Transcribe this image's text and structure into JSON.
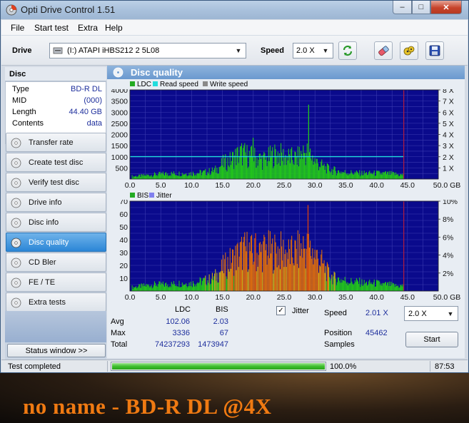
{
  "window": {
    "title": "Opti Drive Control 1.51",
    "minimize": "–",
    "maximize": "□",
    "close": "✕"
  },
  "menu": [
    "File",
    "Start test",
    "Extra",
    "Help"
  ],
  "toolbar": {
    "drive_label": "Drive",
    "drive_value": "(I:)   ATAPI iHBS212   2 5L08",
    "speed_label": "Speed",
    "speed_value": "2.0 X",
    "icons": [
      "refresh-icon",
      "eraser-icon",
      "burn-icon",
      "save-icon"
    ]
  },
  "disc": {
    "header": "Disc",
    "rows": [
      {
        "key": "Type",
        "value": "BD-R DL"
      },
      {
        "key": "MID",
        "value": "(000)"
      },
      {
        "key": "Length",
        "value": "44.40 GB"
      },
      {
        "key": "Contents",
        "value": "data"
      }
    ]
  },
  "nav": [
    {
      "label": "Transfer rate",
      "active": false
    },
    {
      "label": "Create test disc",
      "active": false
    },
    {
      "label": "Verify test disc",
      "active": false
    },
    {
      "label": "Drive info",
      "active": false
    },
    {
      "label": "Disc info",
      "active": false
    },
    {
      "label": "Disc quality",
      "active": true
    },
    {
      "label": "CD Bler",
      "active": false
    },
    {
      "label": "FE / TE",
      "active": false
    },
    {
      "label": "Extra tests",
      "active": false
    }
  ],
  "status_window_button": "Status window >>",
  "panel": {
    "title": "Disc quality"
  },
  "chart_data": [
    {
      "type": "bar",
      "legend": [
        {
          "name": "LDC",
          "color": "#22aa22"
        },
        {
          "name": "Read speed",
          "color": "#22dddd"
        },
        {
          "name": "Write speed",
          "color": "#8a8a8a"
        }
      ],
      "xlim": [
        0,
        50
      ],
      "x_ticks": [
        "0.0",
        "5.0",
        "10.0",
        "15.0",
        "20.0",
        "25.0",
        "30.0",
        "35.0",
        "40.0",
        "45.0",
        "50.0 GB"
      ],
      "ylim": [
        0,
        4000
      ],
      "y_ticks": [
        "500",
        "1000",
        "1500",
        "2000",
        "2500",
        "3000",
        "3500",
        "4000"
      ],
      "y2_ticks": [
        "1 X",
        "2 X",
        "3 X",
        "4 X",
        "5 X",
        "6 X",
        "7 X",
        "8 X"
      ],
      "ldc_profile": [
        [
          0.5,
          120
        ],
        [
          2,
          150
        ],
        [
          4,
          200
        ],
        [
          6,
          240
        ],
        [
          8,
          250
        ],
        [
          10,
          260
        ],
        [
          11,
          280
        ],
        [
          12,
          300
        ],
        [
          13,
          340
        ],
        [
          14,
          420
        ],
        [
          15,
          700
        ],
        [
          16,
          780
        ],
        [
          17,
          1000
        ],
        [
          18,
          1150
        ],
        [
          19,
          1050
        ],
        [
          20,
          980
        ],
        [
          21,
          900
        ],
        [
          22,
          860
        ],
        [
          23,
          1050
        ],
        [
          24,
          1100
        ],
        [
          25,
          1000
        ],
        [
          26,
          950
        ],
        [
          27,
          900
        ],
        [
          28,
          1200
        ],
        [
          29,
          1150
        ],
        [
          30,
          800
        ],
        [
          31,
          600
        ],
        [
          32,
          450
        ],
        [
          33,
          380
        ],
        [
          34,
          330
        ],
        [
          35,
          290
        ],
        [
          36,
          280
        ],
        [
          37,
          260
        ],
        [
          38,
          260
        ],
        [
          39,
          250
        ],
        [
          40,
          260
        ],
        [
          41,
          250
        ],
        [
          42,
          240
        ],
        [
          43,
          220
        ],
        [
          44,
          180
        ]
      ],
      "ldc_spikes": [
        [
          19.9,
          1850
        ],
        [
          28.9,
          3336
        ]
      ],
      "read_speed": [
        [
          0,
          2.01
        ],
        [
          44.4,
          2.01
        ]
      ],
      "marker_x": 44.4
    },
    {
      "type": "bar",
      "legend": [
        {
          "name": "BIS",
          "color": "#22aa22"
        },
        {
          "name": "Jitter",
          "color": "#8080ee"
        }
      ],
      "xlim": [
        0,
        50
      ],
      "x_ticks": [
        "0.0",
        "5.0",
        "10.0",
        "15.0",
        "20.0",
        "25.0",
        "30.0",
        "35.0",
        "40.0",
        "45.0",
        "50.0 GB"
      ],
      "ylim": [
        0,
        70
      ],
      "y_ticks": [
        "10",
        "20",
        "30",
        "40",
        "50",
        "60",
        "70"
      ],
      "y2_ticks": [
        "2%",
        "4%",
        "6%",
        "8%",
        "10%"
      ],
      "bis_profile": [
        [
          0.5,
          3
        ],
        [
          2,
          4
        ],
        [
          4,
          5
        ],
        [
          6,
          5
        ],
        [
          8,
          6
        ],
        [
          10,
          6
        ],
        [
          11,
          7
        ],
        [
          12,
          8
        ],
        [
          13,
          9
        ],
        [
          14,
          12
        ],
        [
          15,
          18
        ],
        [
          16,
          22
        ],
        [
          17,
          26
        ],
        [
          18,
          30
        ],
        [
          19,
          32
        ],
        [
          20,
          28
        ],
        [
          21,
          30
        ],
        [
          22,
          32
        ],
        [
          23,
          30
        ],
        [
          24,
          31
        ],
        [
          25,
          30
        ],
        [
          26,
          28
        ],
        [
          27,
          30
        ],
        [
          28,
          34
        ],
        [
          29,
          32
        ],
        [
          30,
          28
        ],
        [
          31,
          22
        ],
        [
          32,
          14
        ],
        [
          33,
          10
        ],
        [
          34,
          9
        ],
        [
          35,
          8
        ],
        [
          36,
          7
        ],
        [
          37,
          7
        ],
        [
          38,
          6
        ],
        [
          39,
          6
        ],
        [
          40,
          6
        ],
        [
          41,
          5
        ],
        [
          42,
          5
        ],
        [
          43,
          4
        ],
        [
          44,
          4
        ]
      ],
      "bis_spikes": [
        [
          28.8,
          67
        ],
        [
          20.3,
          45
        ]
      ],
      "marker_x": 44.4
    }
  ],
  "stats": {
    "col_ldc": "LDC",
    "col_bis": "BIS",
    "rows": [
      {
        "label": "Avg",
        "ldc": "102.06",
        "bis": "2.03"
      },
      {
        "label": "Max",
        "ldc": "3336",
        "bis": "67"
      },
      {
        "label": "Total",
        "ldc": "74237293",
        "bis": "1473947"
      }
    ],
    "jitter_label": "Jitter",
    "jitter_checked": true,
    "speed_label": "Speed",
    "speed_value": "2.01 X",
    "speed_select": "2.0 X",
    "position_label": "Position",
    "position_value": "45462",
    "samples_label": "Samples",
    "start_button": "Start"
  },
  "statusbar": {
    "status": "Test completed",
    "progress_pct": 100,
    "progress_text": "100.0%",
    "elapsed": "87:53"
  },
  "overlay_caption": "no name - BD-R DL @4X"
}
